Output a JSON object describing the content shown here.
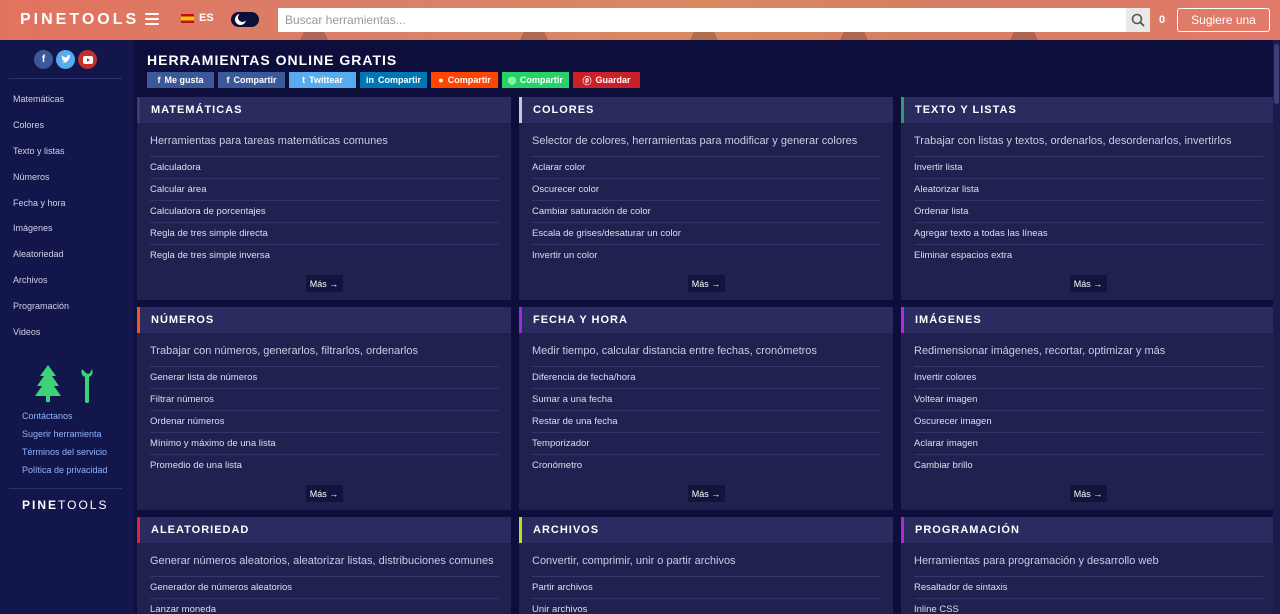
{
  "header": {
    "logo_bold": "PINE",
    "logo_light": "TOOLS",
    "lang": "ES",
    "search_placeholder": "Buscar herramientas...",
    "counter": "0",
    "suggest_label": "Sugiere una"
  },
  "sidebar": {
    "nav": [
      "Matemáticas",
      "Colores",
      "Texto y listas",
      "Números",
      "Fecha y hora",
      "Imágenes",
      "Aleatoriedad",
      "Archivos",
      "Programación",
      "Videos"
    ],
    "footer_links": [
      "Contáctanos",
      "Sugerir herramienta",
      "Términos del servicio",
      "Política de privacidad"
    ],
    "logo_bold": "PINE",
    "logo_light": "TOOLS"
  },
  "main": {
    "title": "HERRAMIENTAS ONLINE GRATIS",
    "share_buttons": [
      {
        "label": "Me gusta",
        "icon": "f",
        "color": "#3b5998",
        "width": 67
      },
      {
        "label": "Compartir",
        "icon": "f",
        "color": "#3b5998",
        "width": 67
      },
      {
        "label": "Twittear",
        "icon": "t",
        "color": "#55acee",
        "width": 67
      },
      {
        "label": "Compartir",
        "icon": "in",
        "color": "#0077b5",
        "width": 67
      },
      {
        "label": "Compartir",
        "icon": "r",
        "color": "#ff4500",
        "width": 67
      },
      {
        "label": "Compartir",
        "icon": "w",
        "color": "#25d366",
        "width": 67
      },
      {
        "label": "Guardar",
        "icon": "p",
        "color": "#cb2027",
        "width": 67
      }
    ],
    "more_label": "Más →",
    "cards": [
      {
        "title": "MATEMÁTICAS",
        "accent": "#3a3d72",
        "desc": "Herramientas para tareas matemáticas comunes",
        "items": [
          "Calculadora",
          "Calcular área",
          "Calculadora de porcentajes",
          "Regla de tres simple directa",
          "Regla de tres simple inversa"
        ]
      },
      {
        "title": "COLORES",
        "accent": "#c9c9d6",
        "desc": "Selector de colores, herramientas para modificar y generar colores",
        "items": [
          "Aclarar color",
          "Oscurecer color",
          "Cambiar saturación de color",
          "Escala de grises/desaturar un color",
          "Invertir un color"
        ]
      },
      {
        "title": "TEXTO Y LISTAS",
        "accent": "#2e9e6b",
        "desc": "Trabajar con listas y textos, ordenarlos, desordenarlos, invertirlos",
        "items": [
          "Invertir lista",
          "Aleatorizar lista",
          "Ordenar lista",
          "Agregar texto a todas las líneas",
          "Eliminar espacios extra"
        ]
      },
      {
        "title": "NÚMEROS",
        "accent": "#e8572e",
        "desc": "Trabajar con números, generarlos, filtrarlos, ordenarlos",
        "items": [
          "Generar lista de números",
          "Filtrar números",
          "Ordenar números",
          "Mínimo y máximo de una lista",
          "Promedio de una lista"
        ]
      },
      {
        "title": "FECHA Y HORA",
        "accent": "#a12bdc",
        "desc": "Medir tiempo, calcular distancia entre fechas, cronómetros",
        "items": [
          "Diferencia de fecha/hora",
          "Sumar a una fecha",
          "Restar de una fecha",
          "Temporizador",
          "Cronómetro"
        ]
      },
      {
        "title": "IMÁGENES",
        "accent": "#b32be0",
        "desc": "Redimensionar imágenes, recortar, optimizar y más",
        "items": [
          "Invertir colores",
          "Voltear imagen",
          "Oscurecer imagen",
          "Aclarar imagen",
          "Cambiar brillo"
        ]
      },
      {
        "title": "ALEATORIEDAD",
        "accent": "#e0223a",
        "desc": "Generar números aleatorios, aleatorizar listas, distribuciones comunes",
        "items": [
          "Generador de números aleatorios",
          "Lanzar moneda"
        ]
      },
      {
        "title": "ARCHIVOS",
        "accent": "#b6e022",
        "desc": "Convertir, comprimir, unir o partir archivos",
        "items": [
          "Partir archivos",
          "Unir archivos"
        ]
      },
      {
        "title": "PROGRAMACIÓN",
        "accent": "#a52bdb",
        "desc": "Herramientas para programación y desarrollo web",
        "items": [
          "Resaltador de sintaxis",
          "Inline CSS"
        ]
      }
    ]
  }
}
